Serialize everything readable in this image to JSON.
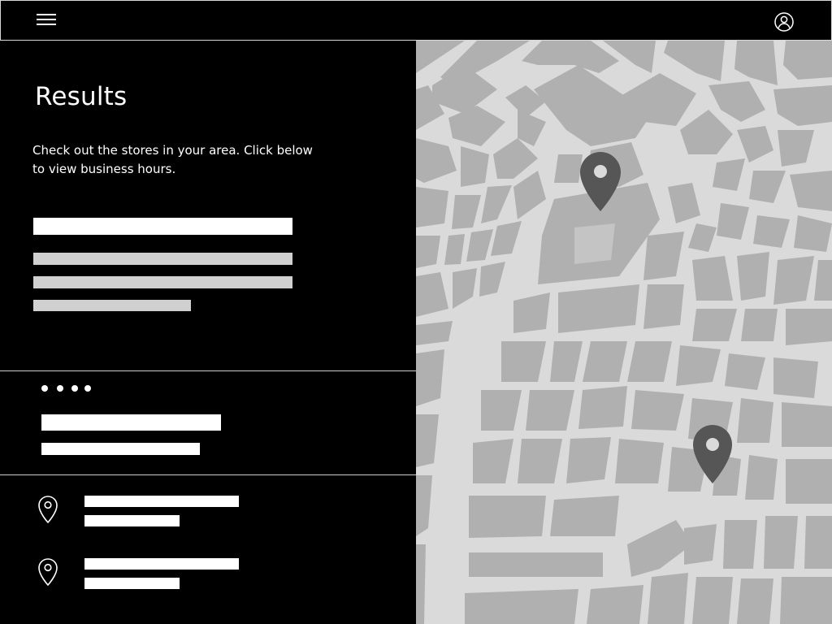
{
  "header": {
    "menu_icon": "hamburger-menu-icon",
    "account_icon": "user-account-icon"
  },
  "results": {
    "title": "Results",
    "description": "Check out the stores in your area. Click below to view business hours."
  },
  "carousel": {
    "indicator_count": 4
  },
  "locations": [
    {
      "icon": "location-pin-icon"
    },
    {
      "icon": "location-pin-icon"
    }
  ],
  "map": {
    "background": "#dadada",
    "block_color": "#b0b0b0",
    "marker_color": "#565656",
    "markers": 2
  },
  "colors": {
    "background": "#000000",
    "text": "#ffffff",
    "placeholder_light": "#ffffff",
    "placeholder_grey": "#d0d0d0"
  }
}
